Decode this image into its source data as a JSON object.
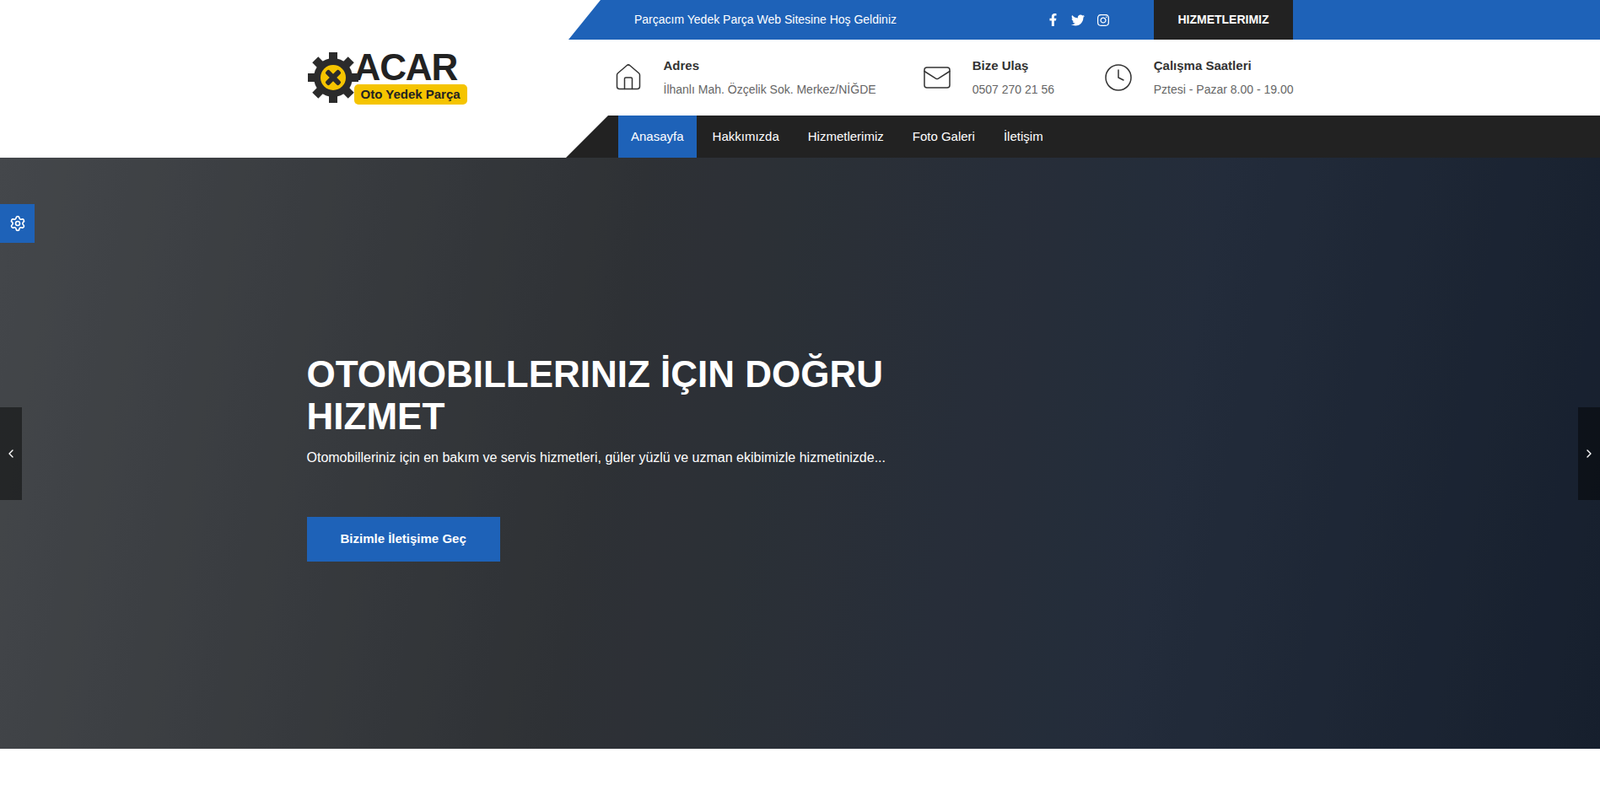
{
  "topbar": {
    "welcome": "Parçacım Yedek Parça Web Sitesine Hoş Geldiniz",
    "button": "HIZMETLERIMIZ"
  },
  "logo": {
    "name": "ACAR",
    "tagline": "Oto Yedek Parça"
  },
  "contacts": [
    {
      "kind": "address",
      "label": "Adres",
      "value": "İlhanlı Mah. Özçelik Sok. Merkez/NİĞDE"
    },
    {
      "kind": "mail",
      "label": "Bize Ulaş",
      "value": "0507 270 21 56"
    },
    {
      "kind": "clock",
      "label": "Çalışma Saatleri",
      "value": "Pztesi - Pazar 8.00 - 19.00"
    }
  ],
  "nav": [
    {
      "label": "Anasayfa",
      "selected": true
    },
    {
      "label": "Hakkımızda",
      "selected": false
    },
    {
      "label": "Hizmetlerimiz",
      "selected": false
    },
    {
      "label": "Foto Galeri",
      "selected": false
    },
    {
      "label": "İletişim",
      "selected": false
    }
  ],
  "hero": {
    "title": "OTOMOBILLERINIZ İÇIN DOĞRU HIZMET",
    "subtitle": "Otomobilleriniz için en bakım ve servis hizmetleri, güler yüzlü ve uzman ekibimizle hizmetinizde...",
    "button": "Bizimle İletişime Geç"
  }
}
